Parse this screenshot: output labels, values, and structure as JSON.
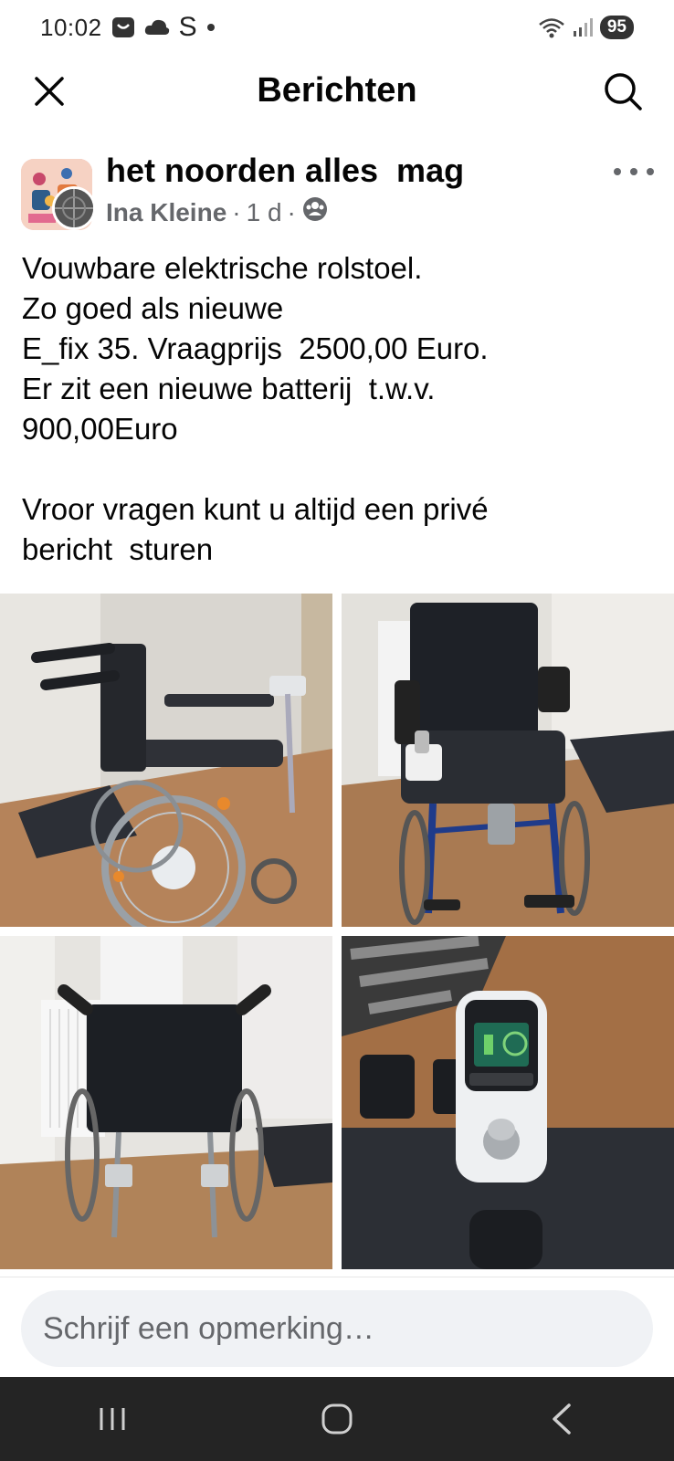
{
  "status_bar": {
    "time": "10:02",
    "carrier_glyph": "S",
    "battery": "95",
    "icons": [
      "message-app-icon",
      "cloud-icon",
      "wifi-icon",
      "signal-icon"
    ]
  },
  "header": {
    "title": "Berichten",
    "close_icon": "close-icon",
    "search_icon": "search-icon"
  },
  "post": {
    "group_name": "het noorden alles  mag",
    "author": "Ina Kleine",
    "separator": "·",
    "time": "1 d",
    "privacy_icon": "group-members-icon",
    "text_lines": [
      "Vouwbare elektrische rolstoel.",
      "Zo goed als nieuwe",
      "E_fix 35. Vraagprijs  2500,00 Euro.",
      "Er zit een nieuwe batterij  t.w.v.",
      "900,00Euro",
      "",
      "Vroor vragen kunt u altijd een privé",
      "bericht  sturen"
    ],
    "photos": [
      {
        "subject": "wheelchair-side-view"
      },
      {
        "subject": "wheelchair-front-view"
      },
      {
        "subject": "wheelchair-back-view"
      },
      {
        "subject": "joystick-controller-closeup"
      }
    ]
  },
  "comment": {
    "placeholder": "Schrijf een opmerking…"
  },
  "nav": {
    "recents_icon": "recents-icon",
    "home_icon": "home-icon",
    "back_icon": "back-icon"
  },
  "colors": {
    "text_primary": "#050505",
    "text_secondary": "#65676b",
    "input_bg": "#f0f2f5",
    "nav_bg": "#242424"
  }
}
